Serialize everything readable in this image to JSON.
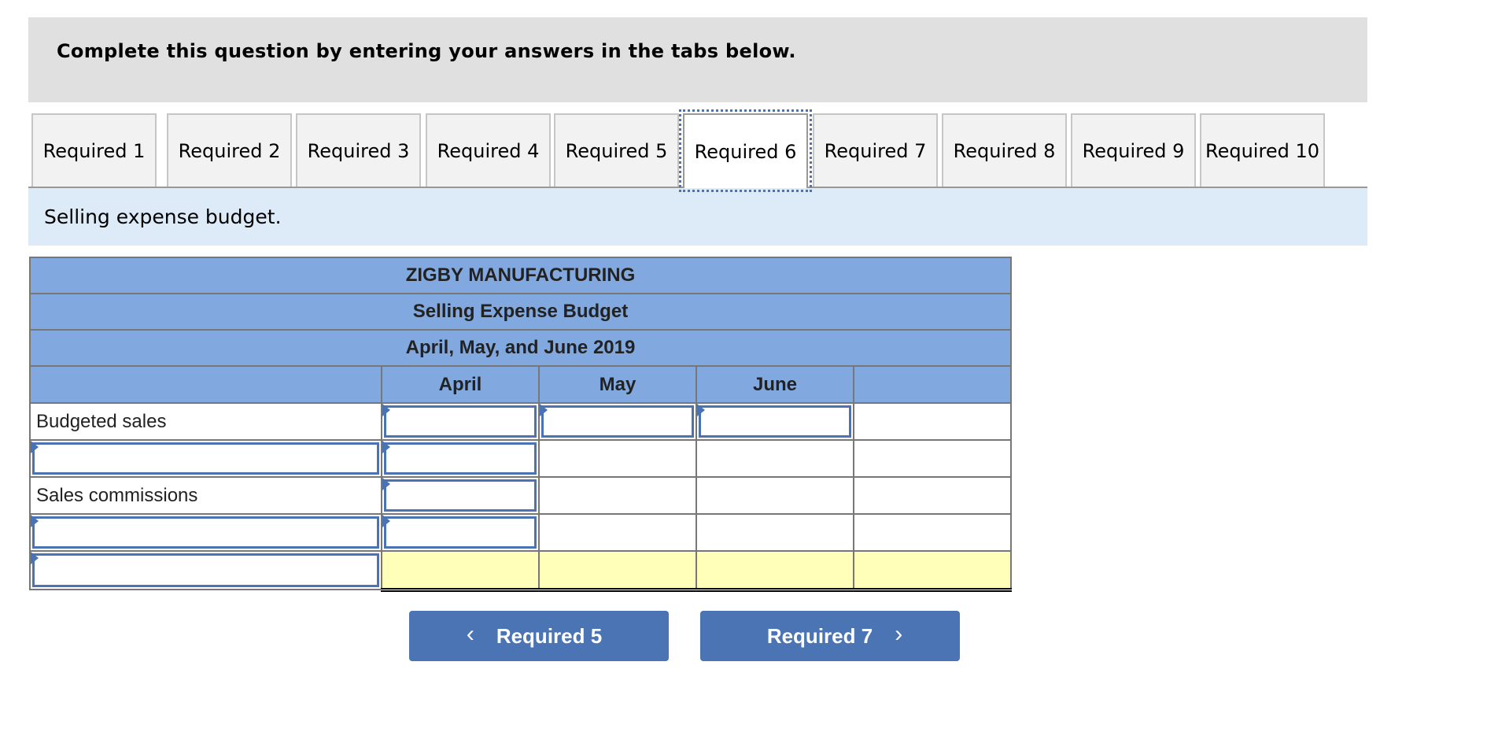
{
  "instruction": "Complete this question by entering your answers in the tabs below.",
  "tabs": [
    {
      "label": "Required 1"
    },
    {
      "label": "Required 2"
    },
    {
      "label": "Required 3"
    },
    {
      "label": "Required 4"
    },
    {
      "label": "Required 5"
    },
    {
      "label": "Required 6",
      "active": true
    },
    {
      "label": "Required 7"
    },
    {
      "label": "Required 8"
    },
    {
      "label": "Required 9"
    },
    {
      "label": "Required 10"
    }
  ],
  "section_title": "Selling expense budget.",
  "budget": {
    "company": "ZIGBY MANUFACTURING",
    "title": "Selling Expense Budget",
    "period": "April, May, and June 2019",
    "columns": [
      "April",
      "May",
      "June",
      ""
    ],
    "rows": [
      {
        "label": "Budgeted sales",
        "label_input": false,
        "cells": [
          "",
          "",
          "",
          ""
        ]
      },
      {
        "label": "",
        "label_input": true,
        "cells": [
          "",
          "",
          "",
          ""
        ]
      },
      {
        "label": "Sales commissions",
        "label_input": false,
        "cells": [
          "",
          "",
          "",
          ""
        ]
      },
      {
        "label": "",
        "label_input": true,
        "cells": [
          "",
          "",
          "",
          ""
        ]
      },
      {
        "label": "",
        "label_input": true,
        "cells": [
          "",
          "",
          "",
          ""
        ],
        "total": true
      }
    ]
  },
  "nav": {
    "prev_label": "Required 5",
    "next_label": "Required 7",
    "prev_icon": "chevron-left",
    "next_icon": "chevron-right"
  },
  "colors": {
    "table_header": "#82a9df",
    "total_row": "#ffffb9",
    "button": "#4a74b4",
    "input_border": "#4a73b3"
  }
}
